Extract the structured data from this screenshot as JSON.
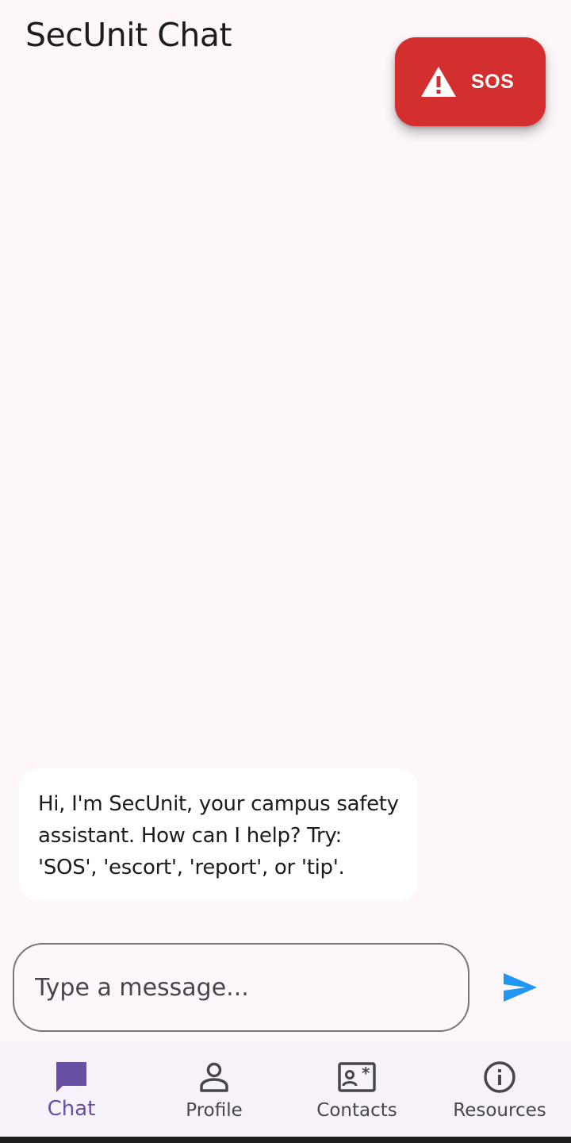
{
  "app": {
    "title": "SecUnit Chat"
  },
  "sos_button": {
    "label": "SOS",
    "icon": "warning-triangle-icon",
    "color": "#D32F2F"
  },
  "messages": [
    {
      "sender": "bot",
      "text": "Hi, I'm SecUnit, your campus safety assistant. How can I help? Try: 'SOS', 'escort', 'report', or 'tip'."
    }
  ],
  "composer": {
    "placeholder": "Type a message...",
    "value": "",
    "send_icon": "send-icon",
    "send_color": "#2196F3"
  },
  "bottom_nav": {
    "selected": "Chat",
    "accent": "#6750A4",
    "items": [
      {
        "label": "Chat",
        "icon": "chat-bubble-icon"
      },
      {
        "label": "Profile",
        "icon": "person-icon"
      },
      {
        "label": "Contacts",
        "icon": "contact-card-icon"
      },
      {
        "label": "Resources",
        "icon": "info-icon"
      }
    ]
  }
}
